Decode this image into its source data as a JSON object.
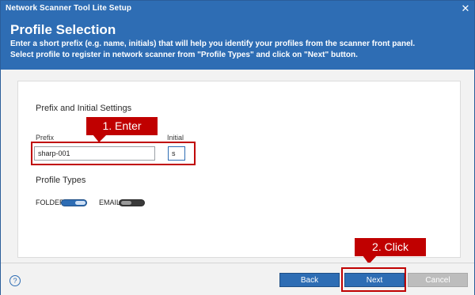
{
  "window": {
    "title": "Network Scanner Tool Lite Setup",
    "close_glyph": "✕"
  },
  "header": {
    "heading": "Profile Selection",
    "description_line1": "Enter a short prefix (e.g. name, initials) that will help you identify your profiles from the scanner front panel.",
    "description_line2": "Select profile to register in network scanner from \"Profile Types\" and click on \"Next\" button."
  },
  "prefix_section": {
    "title": "Prefix and Initial Settings",
    "prefix_label": "Prefix",
    "prefix_value": "sharp-001",
    "initial_label": "Initial",
    "initial_value": "s"
  },
  "profile_types": {
    "title": "Profile Types",
    "items": [
      {
        "label": "FOLDER",
        "state": "on"
      },
      {
        "label": "EMAIL",
        "state": "off"
      }
    ]
  },
  "annotations": {
    "step1": "1. Enter",
    "step2": "2. Click"
  },
  "footer": {
    "help_glyph": "?",
    "back_label": "Back",
    "next_label": "Next",
    "cancel_label": "Cancel"
  },
  "colors": {
    "accent": "#2e6db4",
    "annotation": "#c00000",
    "disabled": "#bdbdbd"
  }
}
